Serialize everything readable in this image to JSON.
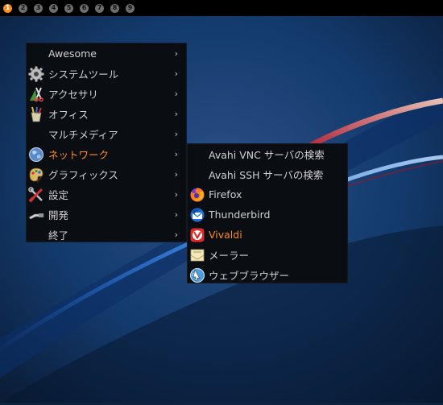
{
  "taglist": [
    "1",
    "2",
    "3",
    "4",
    "5",
    "6",
    "7",
    "8",
    "9"
  ],
  "active_tag_index": 0,
  "colors": {
    "accent": "#ff8c1a",
    "menu_bg": "#0a0d12",
    "text": "#d0d0d0"
  },
  "main_menu": [
    {
      "label": "Awesome",
      "icon": "none"
    },
    {
      "label": "システムツール",
      "icon": "gear-icon"
    },
    {
      "label": "アクセサリ",
      "icon": "accessories-icon"
    },
    {
      "label": "オフィス",
      "icon": "office-icon"
    },
    {
      "label": "マルチメディア",
      "icon": "none"
    },
    {
      "label": "ネットワーク",
      "icon": "globe-icon",
      "selected": true
    },
    {
      "label": "グラフィックス",
      "icon": "palette-icon"
    },
    {
      "label": "設定",
      "icon": "settings-tools-icon"
    },
    {
      "label": "開発",
      "icon": "development-icon"
    },
    {
      "label": "終了",
      "icon": "none"
    }
  ],
  "arrow_glyph": "›",
  "sub_menu": [
    {
      "label": "Avahi VNC サーバの検索",
      "icon": "none"
    },
    {
      "label": "Avahi SSH サーバの検索",
      "icon": "none"
    },
    {
      "label": "Firefox",
      "icon": "firefox-icon"
    },
    {
      "label": "Thunderbird",
      "icon": "thunderbird-icon"
    },
    {
      "label": "Vivaldi",
      "icon": "vivaldi-icon",
      "selected": true
    },
    {
      "label": "メーラー",
      "icon": "mail-icon"
    },
    {
      "label": "ウェブブラウザー",
      "icon": "web-browser-icon"
    }
  ]
}
